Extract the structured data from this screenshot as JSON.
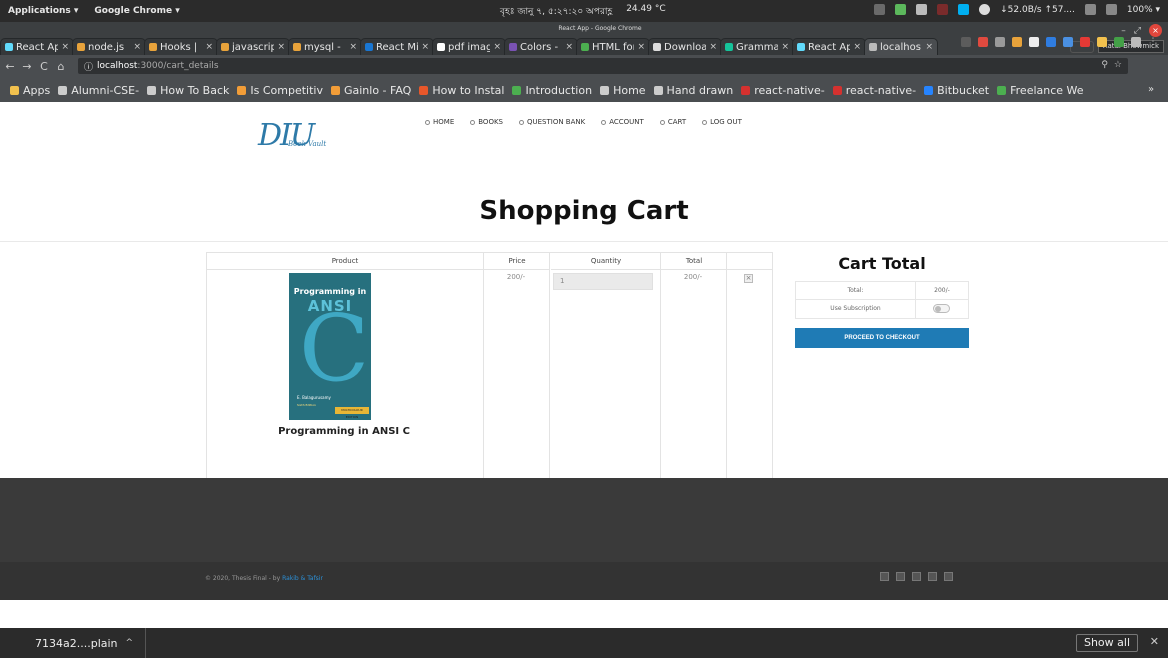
{
  "os": {
    "applications": "Applications ▾",
    "chrome_menu": "Google Chrome ▾",
    "datetime": "বৃহঃ জানু ৭, ৫:২৭:২০ অপরাহ্ণ",
    "temperature": "24.49 °C",
    "network": "↓52.0B/s ↑57....",
    "battery": "100% ▾",
    "window_title": "React App - Google Chrome"
  },
  "tabs": [
    {
      "label": "React Ap",
      "color": "#61dafb"
    },
    {
      "label": "node.js",
      "color": "#e8a33b"
    },
    {
      "label": "Hooks |",
      "color": "#e8a33b"
    },
    {
      "label": "javascrip",
      "color": "#e8a33b"
    },
    {
      "label": "mysql -",
      "color": "#e8a33b"
    },
    {
      "label": "React Mi",
      "color": "#1976d2"
    },
    {
      "label": "pdf imag",
      "color": "#ffffff"
    },
    {
      "label": "Colors -",
      "color": "#7952b3"
    },
    {
      "label": "HTML for",
      "color": "#4caf50"
    },
    {
      "label": "Downloa",
      "color": "#dddddd"
    },
    {
      "label": "Gramma",
      "color": "#15c39a"
    },
    {
      "label": "React Ap",
      "color": "#61dafb"
    },
    {
      "label": "localhos",
      "color": "#bbbbbb"
    }
  ],
  "profile": "Ratul Bhowmick",
  "address": {
    "host": "localhost",
    "path": ":3000/cart_details"
  },
  "bookmarks": [
    {
      "label": "Apps",
      "color": "#f2c14e"
    },
    {
      "label": "Alumni-CSE-",
      "color": "#cccccc"
    },
    {
      "label": "How To Back",
      "color": "#cccccc"
    },
    {
      "label": "Is Competitiv",
      "color": "#f29d38"
    },
    {
      "label": "Gainlo - FAQ",
      "color": "#f29d38"
    },
    {
      "label": "How to Instal",
      "color": "#e8572a"
    },
    {
      "label": "Introduction",
      "color": "#4caf50"
    },
    {
      "label": "Home",
      "color": "#cccccc"
    },
    {
      "label": "Hand drawn",
      "color": "#cccccc"
    },
    {
      "label": "react-native-",
      "color": "#d5312f"
    },
    {
      "label": "react-native-",
      "color": "#d5312f"
    },
    {
      "label": "Bitbucket",
      "color": "#2684ff"
    },
    {
      "label": "Freelance We",
      "color": "#4caf50"
    }
  ],
  "site": {
    "logo_big": "DIU",
    "logo_small": "Book Vault",
    "nav": [
      "HOME",
      "BOOKS",
      "QUESTION BANK",
      "ACCOUNT",
      "CART",
      "LOG OUT"
    ],
    "heading": "Shopping Cart"
  },
  "cart": {
    "headers": [
      "Product",
      "Price",
      "Quantity",
      "Total"
    ],
    "item": {
      "name": "Programming in ANSI C",
      "price": "200/-",
      "quantity": "1",
      "total": "200/-",
      "cover": {
        "title_line1": "Programming in",
        "title_line2": "ANSI",
        "big_letter": "C",
        "author": "E. Balagurusamy",
        "edition": "Sixth Edition",
        "badge": "MULTICOLOUR EDITION"
      }
    }
  },
  "cart_total": {
    "title": "Cart Total",
    "total_label": "Total:",
    "total_value": "200/-",
    "subscription_label": "Use Subscription",
    "checkout": "PROCEED TO CHECKOUT"
  },
  "footer": {
    "copyright": "© 2020, Thesis Final - by ",
    "authors": "Rakib & Tafsir"
  },
  "downloads": {
    "file": "7134a2....plain",
    "show_all": "Show all"
  }
}
